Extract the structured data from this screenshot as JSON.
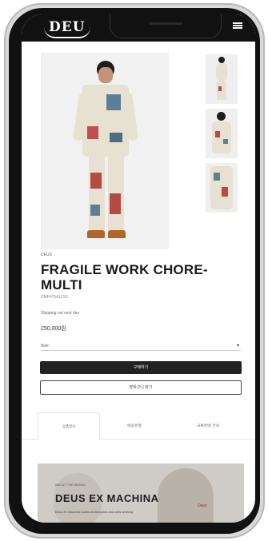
{
  "header": {
    "logo_text": "DEU"
  },
  "product": {
    "brand_label": "DEUS",
    "title": "FRAGILE WORK CHORE-MULTI",
    "sku": "DMF47541ZS6",
    "note": "Shipping out next day",
    "price": "250,000원",
    "option_select": {
      "selected": "Size"
    },
    "buy_button": "구매하기",
    "cart_button": "장바구니 담기"
  },
  "tabs": [
    {
      "label": "상품정보"
    },
    {
      "label": "배송/반품"
    },
    {
      "label": "교환/반품 안내"
    }
  ],
  "banner": {
    "small_label": "ABOUT THE BRAND",
    "title": "DEUS EX MACHINA",
    "copy": "Deus Ex Machina builds motorcycles and sells clothing",
    "tag": "Deus"
  },
  "colors": {
    "frame": "#111111",
    "primary_button": "#222222",
    "shoe": "#b2662c",
    "jacket": "#e7e1d2",
    "banner_bg": "#cfccc8"
  },
  "icons": {
    "menu": "hamburger-menu-icon",
    "select_arrow": "chevron-down-icon"
  }
}
